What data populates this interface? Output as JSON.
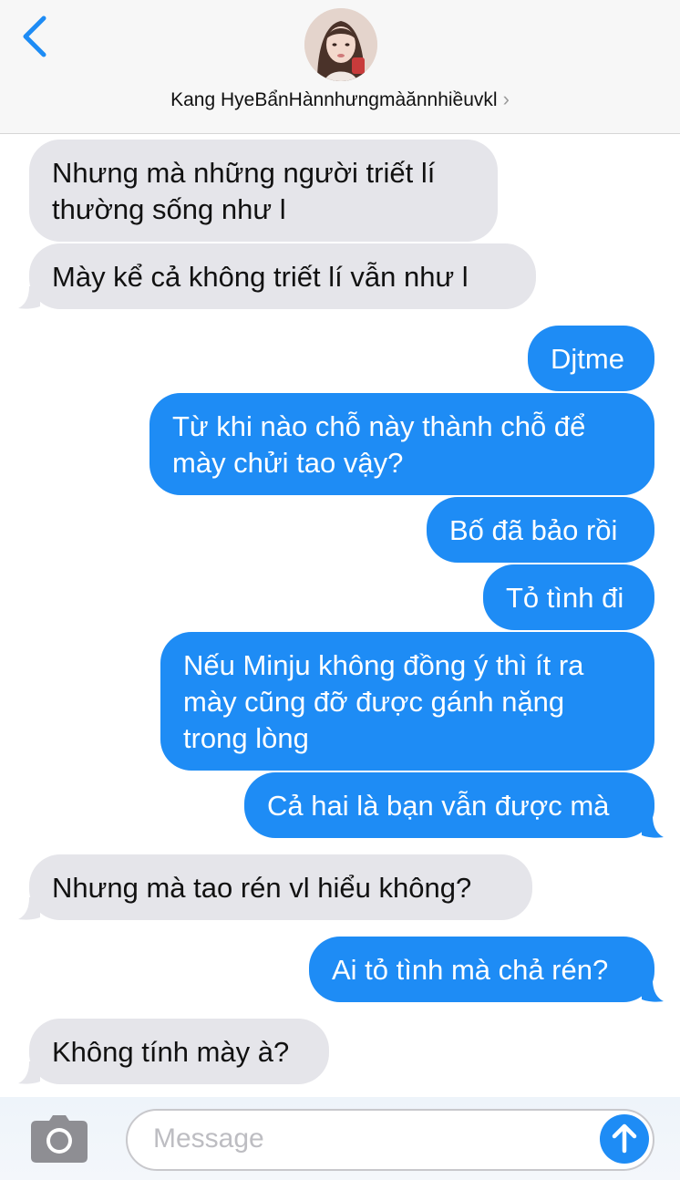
{
  "header": {
    "back_icon": "chevron-left-icon",
    "contact_name": "Kang HyeBẩnHànnhưngmàănnhiềuvkl",
    "contact_chevron": "›",
    "accent_color": "#1e8cf5"
  },
  "messages": [
    {
      "side": "in",
      "text": "Nhưng mà những người triết lí\nthường sống như l"
    },
    {
      "side": "in",
      "text": "Mày kể cả không triết lí vẫn như l"
    },
    {
      "side": "out",
      "text": "Djtme"
    },
    {
      "side": "out",
      "text": "Từ khi nào chỗ này thành chỗ để\nmày chửi tao vậy?"
    },
    {
      "side": "out",
      "text": "Bố đã bảo rồi"
    },
    {
      "side": "out",
      "text": "Tỏ tình đi"
    },
    {
      "side": "out",
      "text": "Nếu Minju không đồng ý thì ít ra\nmày cũng đỡ được gánh nặng\ntrong lòng"
    },
    {
      "side": "out",
      "text": "Cả hai là bạn vẫn được mà"
    },
    {
      "side": "in",
      "text": "Nhưng mà tao rén vl hiểu không?"
    },
    {
      "side": "out",
      "text": "Ai tỏ tình mà chả rén?"
    },
    {
      "side": "in",
      "text": "Không tính mày à?"
    }
  ],
  "composer": {
    "camera_icon": "camera-icon",
    "placeholder": "Message",
    "send_icon": "arrow-up-icon"
  },
  "colors": {
    "incoming_bubble": "#e5e5ea",
    "outgoing_bubble": "#1e8cf5"
  }
}
